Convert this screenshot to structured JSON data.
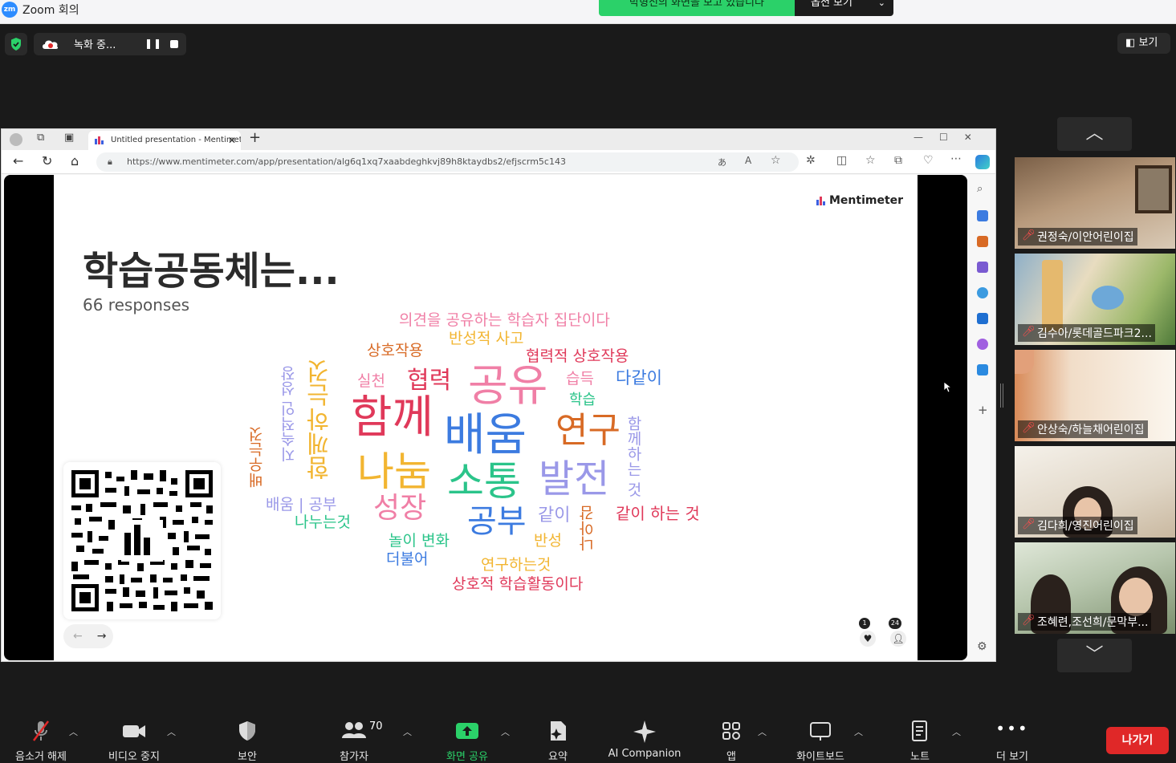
{
  "app": {
    "title": "Zoom 회의",
    "logo": "zm"
  },
  "share_banner": {
    "text": "박형신의 화면을 보고 있습니다",
    "options_label": "옵션 보기"
  },
  "recording": {
    "label": "녹화 중...",
    "pause": "❚❚"
  },
  "view_button": "보기",
  "browser": {
    "tab_title": "Untitled presentation - Mentimeter",
    "url": "https://www.mentimeter.com/app/presentation/alg6q1xq7xaabdeghkvj89h8ktaydbs2/efjscrm5c143",
    "new_tab": "+"
  },
  "slide": {
    "brand": "Mentimeter",
    "title": "학습공동체는...",
    "responses": "66 responses",
    "reaction_hearts": "1",
    "reaction_users": "24"
  },
  "word_cloud": [
    {
      "text": "의견을 공유하는 학습자 집단이다",
      "color": "#f07fa6"
    },
    {
      "text": "반성적 사고",
      "color": "#f2b531"
    },
    {
      "text": "상호작용",
      "color": "#d86a25"
    },
    {
      "text": "협력적 상호작용",
      "color": "#e0395a"
    },
    {
      "text": "실천",
      "color": "#f07fa6"
    },
    {
      "text": "협력",
      "color": "#e0395a"
    },
    {
      "text": "공유",
      "color": "#f07fa6"
    },
    {
      "text": "습득",
      "color": "#f07fa6"
    },
    {
      "text": "다같이",
      "color": "#3c7be0"
    },
    {
      "text": "학습",
      "color": "#2bc48a"
    },
    {
      "text": "함께",
      "color": "#e0395a"
    },
    {
      "text": "배움",
      "color": "#3c7be0"
    },
    {
      "text": "연구",
      "color": "#d86a25"
    },
    {
      "text": "나눔",
      "color": "#f2b531"
    },
    {
      "text": "소통",
      "color": "#2bc48a"
    },
    {
      "text": "발전",
      "color": "#9a98e8"
    },
    {
      "text": "성장",
      "color": "#f07fa6"
    },
    {
      "text": "공부",
      "color": "#3c7be0"
    },
    {
      "text": "같이",
      "color": "#9a98e8"
    },
    {
      "text": "같이 하는 것",
      "color": "#e0395a"
    },
    {
      "text": "배움 | 공부",
      "color": "#9a98e8"
    },
    {
      "text": "나누는것",
      "color": "#2bc48a"
    },
    {
      "text": "놀이 변화",
      "color": "#2bc48a"
    },
    {
      "text": "반성",
      "color": "#f2b531"
    },
    {
      "text": "더불어",
      "color": "#3c7be0"
    },
    {
      "text": "연구하는것",
      "color": "#f2b531"
    },
    {
      "text": "상호적 학습활동이다",
      "color": "#e0395a"
    },
    {
      "text": "배우는것",
      "color": "#d86a25"
    },
    {
      "text": "지속적인 성장",
      "color": "#9a98e8"
    },
    {
      "text": "함께하는것",
      "color": "#f2b531"
    },
    {
      "text": "함께하는 것",
      "color": "#9a98e8"
    },
    {
      "text": "나아감",
      "color": "#d86a25"
    }
  ],
  "participants": [
    {
      "name": "권정숙/이안어린이집"
    },
    {
      "name": "김수아/롯데골드파크2..."
    },
    {
      "name": "안상숙/하늘채어린이집"
    },
    {
      "name": "김다희/영진어린이집"
    },
    {
      "name": "조혜련,조선희/문막부..."
    }
  ],
  "toolbar": {
    "mute": "음소거 해제",
    "video": "비디오 중지",
    "security": "보안",
    "participants": "참가자",
    "participants_count": "70",
    "share": "화면 공유",
    "summary": "요약",
    "ai": "AI Companion",
    "apps": "앱",
    "whiteboard": "화이트보드",
    "notes": "노트",
    "more": "더 보기",
    "leave": "나가기"
  }
}
